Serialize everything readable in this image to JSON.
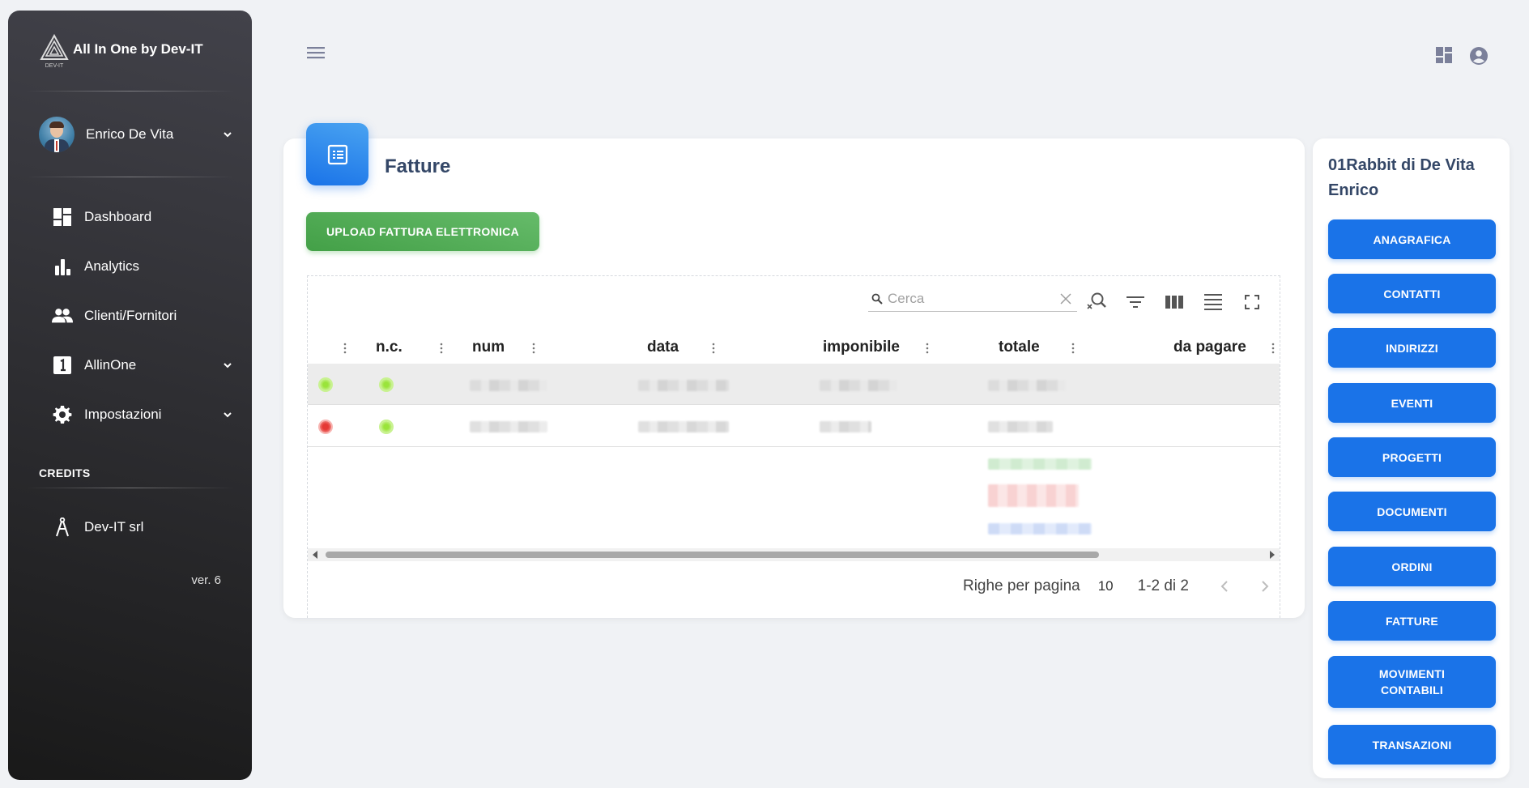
{
  "app": {
    "title": "All In One by Dev-IT",
    "logo_caption": "DEV-IT"
  },
  "sidebar": {
    "user_name": "Enrico De Vita",
    "items": [
      {
        "label": "Dashboard",
        "icon": "dashboard-icon"
      },
      {
        "label": "Analytics",
        "icon": "bar-chart-icon"
      },
      {
        "label": "Clienti/Fornitori",
        "icon": "people-icon"
      },
      {
        "label": "AllinOne",
        "icon": "looks-one-icon"
      },
      {
        "label": "Impostazioni",
        "icon": "gear-icon"
      }
    ],
    "credits_heading": "CREDITS",
    "credits_item": "Dev-IT srl",
    "version": "ver. 6"
  },
  "main": {
    "title": "Fatture",
    "upload_button": "UPLOAD FATTURA ELETTRONICA",
    "search_placeholder": "Cerca",
    "columns": [
      "",
      "n.c.",
      "num",
      "data",
      "imponibile",
      "totale",
      "da pagare"
    ],
    "rows": [
      {
        "status_color": "#9ae43b",
        "nc_color": "#9ae43b"
      },
      {
        "status_color": "#e53935",
        "nc_color": "#9ae43b"
      }
    ],
    "pagination": {
      "rows_per_page_label": "Righe per pagina",
      "rows_per_page": "10",
      "range": "1-2 di 2"
    }
  },
  "right_panel": {
    "company": "01Rabbit di De Vita Enrico",
    "buttons": [
      "ANAGRAFICA",
      "CONTATTI",
      "INDIRIZZI",
      "EVENTI",
      "PROGETTI",
      "DOCUMENTI",
      "ORDINI",
      "FATTURE",
      "MOVIMENTI CONTABILI",
      "TRANSAZIONI"
    ]
  },
  "colors": {
    "primary": "#1a73e8",
    "success": "#4caf50",
    "sidebar": "#202020",
    "status_green": "#9ae43b",
    "status_red": "#e53935"
  }
}
